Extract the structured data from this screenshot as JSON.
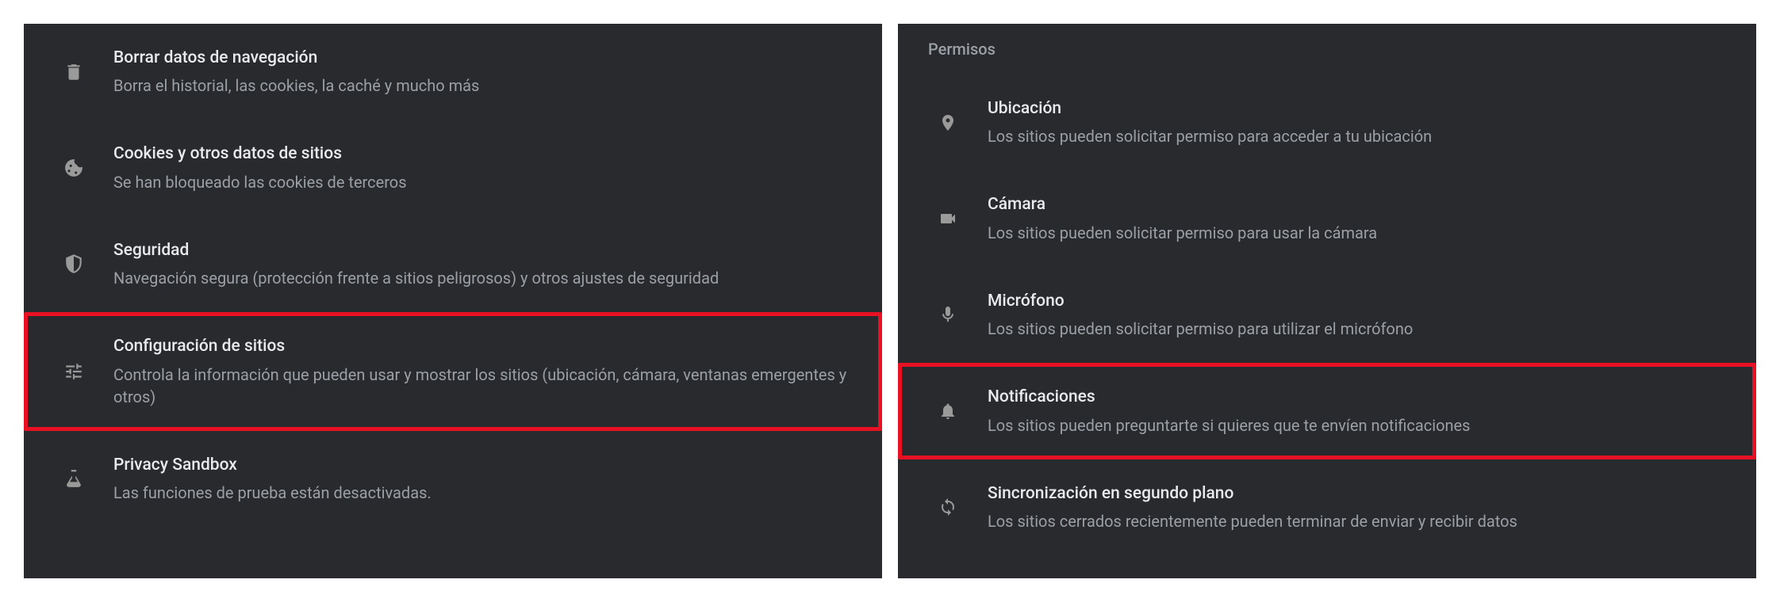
{
  "left": {
    "items": [
      {
        "title": "Borrar datos de navegación",
        "subtitle": "Borra el historial, las cookies, la caché y mucho más",
        "icon": "trash-icon",
        "highlight": false
      },
      {
        "title": "Cookies y otros datos de sitios",
        "subtitle": "Se han bloqueado las cookies de terceros",
        "icon": "cookie-icon",
        "highlight": false
      },
      {
        "title": "Seguridad",
        "subtitle": "Navegación segura (protección frente a sitios peligrosos) y otros ajustes de seguridad",
        "icon": "shield-icon",
        "highlight": false
      },
      {
        "title": "Configuración de sitios",
        "subtitle": "Controla la información que pueden usar y mostrar los sitios (ubicación, cámara, ventanas emergentes y otros)",
        "icon": "tune-icon",
        "highlight": true
      },
      {
        "title": "Privacy Sandbox",
        "subtitle": "Las funciones de prueba están desactivadas.",
        "icon": "flask-icon",
        "highlight": false
      }
    ]
  },
  "right": {
    "header": "Permisos",
    "items": [
      {
        "title": "Ubicación",
        "subtitle": "Los sitios pueden solicitar permiso para acceder a tu ubicación",
        "icon": "location-icon",
        "highlight": false
      },
      {
        "title": "Cámara",
        "subtitle": "Los sitios pueden solicitar permiso para usar la cámara",
        "icon": "camera-icon",
        "highlight": false
      },
      {
        "title": "Micrófono",
        "subtitle": "Los sitios pueden solicitar permiso para utilizar el micrófono",
        "icon": "microphone-icon",
        "highlight": false
      },
      {
        "title": "Notificaciones",
        "subtitle": "Los sitios pueden preguntarte si quieres que te envíen notificaciones",
        "icon": "bell-icon",
        "highlight": true
      },
      {
        "title": "Sincronización en segundo plano",
        "subtitle": "Los sitios cerrados recientemente pueden terminar de enviar y recibir datos",
        "icon": "sync-icon",
        "highlight": false
      }
    ]
  }
}
